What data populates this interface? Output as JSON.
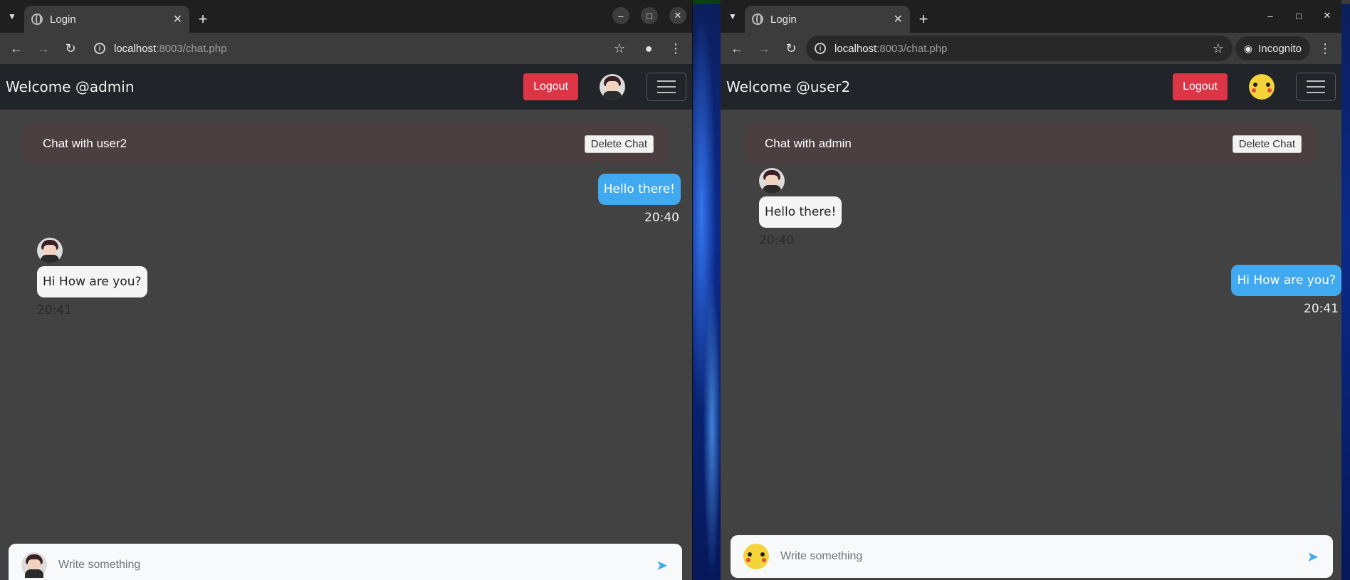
{
  "windows": [
    {
      "tab_title": "Login",
      "url_host": "localhost",
      "url_rest": ":8003/chat.php",
      "welcome": "Welcome @admin",
      "logout_label": "Logout",
      "chat_title": "Chat with user2",
      "delete_label": "Delete Chat",
      "messages": [
        {
          "direction": "sent",
          "text": "Hello there!",
          "time": "20:40"
        },
        {
          "direction": "received",
          "text": "Hi How are you?",
          "time": "20:41"
        }
      ],
      "composer_placeholder": "Write something",
      "avatar": "boy-avatar-icon"
    },
    {
      "tab_title": "Login",
      "url_host": "localhost",
      "url_rest": ":8003/chat.php",
      "incognito_label": "Incognito",
      "welcome": "Welcome @user2",
      "logout_label": "Logout",
      "chat_title": "Chat with admin",
      "delete_label": "Delete Chat",
      "messages": [
        {
          "direction": "received",
          "text": "Hello there!",
          "time": "20:40"
        },
        {
          "direction": "sent",
          "text": "Hi How are you?",
          "time": "20:41"
        }
      ],
      "composer_placeholder": "Write something",
      "avatar": "pikachu-avatar-icon"
    }
  ],
  "colors": {
    "logout": "#dc3545",
    "sent_bubble": "#40a9f0",
    "navbar": "#212529",
    "page_bg": "#424242",
    "chat_header": "#4b3f3f"
  }
}
